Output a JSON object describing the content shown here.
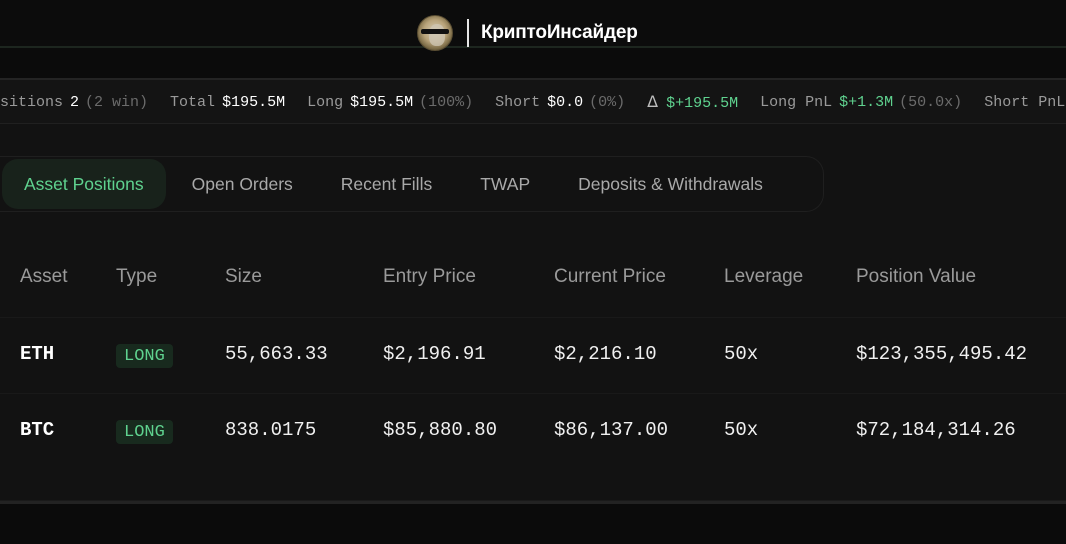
{
  "header": {
    "brand_name": "КриптоИнсайдер",
    "avatar_icon": "profile-avatar"
  },
  "stats": {
    "positions": {
      "label": "Positions",
      "value": "2",
      "sub": "(2 win)"
    },
    "total": {
      "label": "Total",
      "value": "$195.5M"
    },
    "long": {
      "label": "Long",
      "value": "$195.5M",
      "sub": "(100%)"
    },
    "short": {
      "label": "Short",
      "value": "$0.0",
      "sub": "(0%)"
    },
    "delta": {
      "icon": "Δ",
      "value": "$+195.5M"
    },
    "long_pnl": {
      "label": "Long PnL",
      "value": "$+1.3M",
      "sub": "(50.0x)"
    },
    "short_pnl": {
      "label": "Short PnL"
    }
  },
  "tabs": [
    {
      "label": "Asset Positions",
      "active": true
    },
    {
      "label": "Open Orders",
      "active": false
    },
    {
      "label": "Recent Fills",
      "active": false
    },
    {
      "label": "TWAP",
      "active": false
    },
    {
      "label": "Deposits & Withdrawals",
      "active": false
    }
  ],
  "table": {
    "columns": [
      "Asset",
      "Type",
      "Size",
      "Entry Price",
      "Current Price",
      "Leverage",
      "Position Value"
    ],
    "rows": [
      {
        "asset": "ETH",
        "type": "LONG",
        "size": "55,663.33",
        "entry_price": "$2,196.91",
        "current_price": "$2,216.10",
        "leverage": "50x",
        "position_value": "$123,355,495.42"
      },
      {
        "asset": "BTC",
        "type": "LONG",
        "size": "838.0175",
        "entry_price": "$85,880.80",
        "current_price": "$86,137.00",
        "leverage": "50x",
        "position_value": "$72,184,314.26"
      }
    ]
  },
  "colors": {
    "accent_green": "#5fd28f",
    "background": "#121212",
    "muted_text": "#9a9a9a"
  }
}
